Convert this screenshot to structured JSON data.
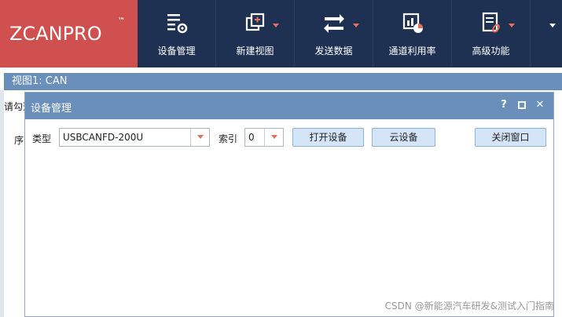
{
  "logo": {
    "brand": "ZCANPRO",
    "tm": "™"
  },
  "toolbar": {
    "items": [
      {
        "label": "设备管理",
        "icon": "device-management-icon"
      },
      {
        "label": "新建视图",
        "icon": "new-view-icon"
      },
      {
        "label": "发送数据",
        "icon": "send-data-icon"
      },
      {
        "label": "通道利用率",
        "icon": "channel-usage-icon"
      },
      {
        "label": "高级功能",
        "icon": "advanced-features-icon"
      }
    ]
  },
  "view": {
    "title": "视图1: CAN",
    "hint": "请勾选",
    "seq_label": "序"
  },
  "dialog": {
    "title": "设备管理",
    "help": "?",
    "maximize": "□",
    "close": "✕",
    "type_label": "类型",
    "type_value": "USBCANFD-200U",
    "index_label": "索引",
    "index_value": "0",
    "open_button": "打开设备",
    "cloud_button": "云设备",
    "close_window_button": "关闭窗口"
  },
  "watermark": "CSDN @新能源汽车研发&测试入门指南",
  "colors": {
    "toolbar_bg": "#1f3152",
    "logo_bg": "#d04f4f",
    "title_bar": "#6b8fbb",
    "button_bg": "#d4e5f8",
    "accent_arrow": "#e0705a"
  }
}
